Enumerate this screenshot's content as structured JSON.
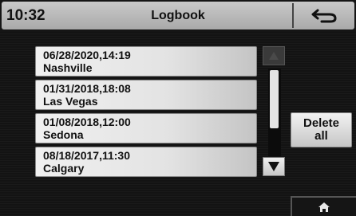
{
  "header": {
    "time": "10:32",
    "title": "Logbook",
    "back_icon": "back-arrow-icon"
  },
  "entries": [
    {
      "datetime": "06/28/2020,14:19",
      "location": "Nashville"
    },
    {
      "datetime": "01/31/2018,18:08",
      "location": "Las Vegas"
    },
    {
      "datetime": "01/08/2018,12:00",
      "location": "Sedona"
    },
    {
      "datetime": "08/18/2017,11:30",
      "location": "Calgary"
    }
  ],
  "actions": {
    "delete_all_label": "Delete\nall"
  },
  "scrollbar": {
    "up_icon": "scroll-up-icon",
    "down_icon": "scroll-down-icon"
  },
  "footer": {
    "home_icon": "home-icon"
  },
  "colors": {
    "header_bg": "#b9b9b9",
    "screen_bg": "#151515",
    "button_bg": "#e3e3e3"
  }
}
